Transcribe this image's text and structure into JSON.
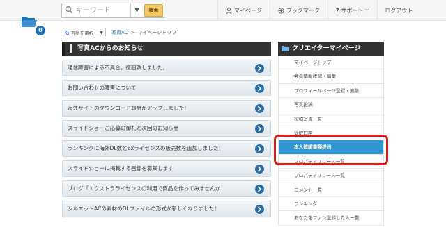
{
  "header": {
    "search_placeholder": "キーワード",
    "search_dropdown_icon": "chevron-down",
    "search_button_label": "検索",
    "nav": [
      {
        "label": "マイページ",
        "icon": "user-icon"
      },
      {
        "label": "ブックマーク",
        "icon": "plus-circle-icon"
      },
      {
        "label": "サポート",
        "icon": "question-icon"
      },
      {
        "label": "ログアウト",
        "icon": ""
      }
    ]
  },
  "folder": {
    "count": "0",
    "icon": "folder-icon",
    "accent": "#1a6fb1"
  },
  "translate": {
    "label": "言語を選択"
  },
  "breadcrumb": {
    "home": "写真AC",
    "separator": ">",
    "current": "マイページトップ"
  },
  "news": {
    "title": "写真ACからのお知らせ",
    "items": [
      "通信障害による不具合。復旧致しました。",
      "お問い合わせの障害について",
      "海外サイトのダウンロード報酬がアップしました！",
      "スライドショーご応募の御礼と次回のお知らせ",
      "ランキングに海外DL数とExライセンスの販売数を追加しました！",
      "スライドショーに掲載する画像を募集します",
      "ブログ「エクストラライセンスの利用で商品を作ってみませんか",
      "シルエットACの素材のDLファイルの形式が新しくなりました！"
    ]
  },
  "creator_menu": {
    "title": "クリエイターマイページ",
    "items": [
      "マイページトップ",
      "会員情報確認・編集",
      "プロフィールページ登録・編集",
      "写真投稿",
      "投稿写真一覧",
      "受取口座",
      "本人確認書類提出",
      "プロパティリリース一覧",
      "プロパティリリース一覧",
      "コメント一覧",
      "ランキング",
      "あなたをファン登録した人一覧"
    ],
    "active_index": 6
  },
  "colors": {
    "accent": "#2f97d0",
    "highlight": "#e01919",
    "header_dark": "#333333"
  }
}
